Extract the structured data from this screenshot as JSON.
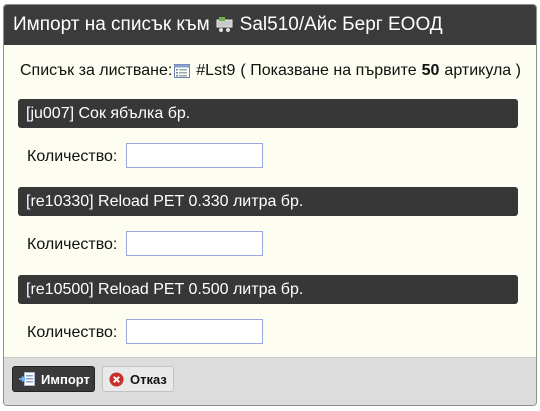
{
  "dialog": {
    "title_prefix": "Импорт на списък към",
    "client_name": "Sal510/Айс Берг ЕООД"
  },
  "list_info": {
    "label": "Списък за листване:",
    "list_id": "#Lst9",
    "showing_prefix": "( Показване на първите",
    "showing_count": "50",
    "showing_suffix": "артикула )"
  },
  "items": [
    {
      "header": "[ju007] Сок ябълка бр.",
      "quantity_label": "Количество:",
      "quantity_value": ""
    },
    {
      "header": "[re10330] Reload PET 0.330 литра бр.",
      "quantity_label": "Количество:",
      "quantity_value": ""
    },
    {
      "header": "[re10500] Reload PET 0.500 литра бр.",
      "quantity_label": "Количество:",
      "quantity_value": ""
    }
  ],
  "footer": {
    "import_label": "Импорт",
    "cancel_label": "Отказ"
  },
  "icons": {
    "client": "client-cart-icon",
    "list": "list-icon",
    "import": "import-icon",
    "cancel": "cancel-icon"
  },
  "colors": {
    "title_bar": "#3b3b3b",
    "item_header": "#373737",
    "dialog_bg": "#fdfdf1",
    "cancel_red": "#c9302c"
  }
}
